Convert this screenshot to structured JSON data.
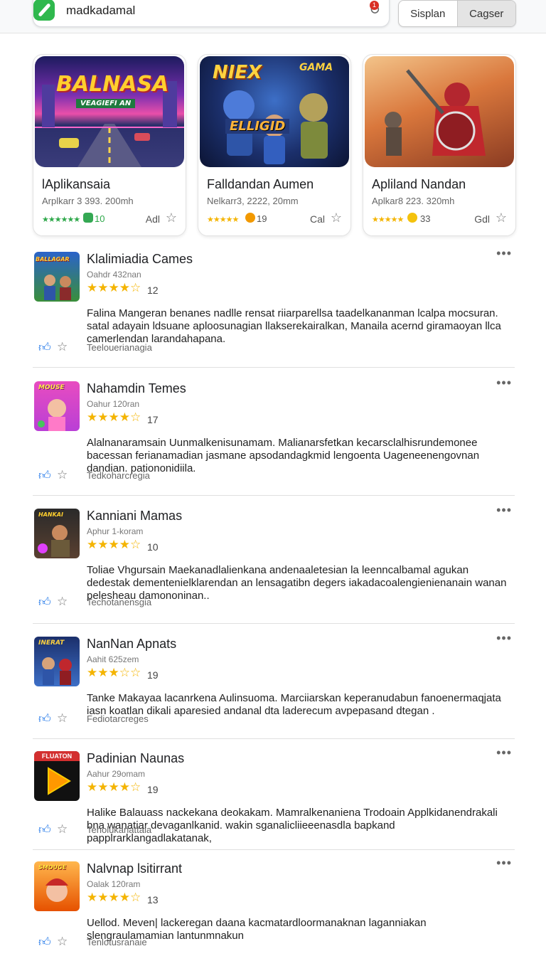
{
  "header": {
    "query": "madkadamal",
    "notification_count": "1",
    "tabs": [
      "Sisplan",
      "Cagser"
    ],
    "active_tab": 1
  },
  "featured": [
    {
      "banner_title": "BALNASA",
      "banner_subtitle": "VEAGIEFI AN",
      "title": "lAplikansaia",
      "subtitle": "Arplkarr 3 393. 200mh",
      "stars": "★★★★★★",
      "count": "10",
      "action": "Adl",
      "badge_color": "#34a853"
    },
    {
      "banner_title": "NIEX",
      "banner_tag": "GAMA",
      "banner_subtitle": "ELLIGID",
      "title": "Falldandan Aumen",
      "subtitle": "Nelkarr3, 2222, 20mm",
      "stars": "★★★★★",
      "count": "19",
      "action": "Cal",
      "badge_color": "#f29900"
    },
    {
      "title": "Apliland Nandan",
      "subtitle": "Aplkar8 223. 320mh",
      "stars": "★★★★★",
      "count": "33",
      "action": "Gdl",
      "badge_color": "#f4c20d"
    }
  ],
  "apps": [
    {
      "title": "Klalimiadia Cames",
      "author": "Oahdr 432nan",
      "stars": "★★★★☆",
      "count": "12",
      "description": "Falina Mangeran benanes nadlle rensat riiarparellsa taadelkananman lcalpa mocsuran. satal adayain ldsuane aploosunagian llakserekairalkan, Manaila acernd giramaoyan llca camerlendan larandahapana.",
      "category": "Teelouerianagia",
      "icon_text": "BALLAGAR"
    },
    {
      "title": "Nahamdin Temes",
      "author": "Oahur 120ran",
      "stars": "★★★★☆",
      "count": "17",
      "description": "Alalnanaramsain Uunmalkenisunamam. Malianarsfetkan kecarsclalhisrundemonee bacessan ferianamadian jasmane apsodandagkmid lengoenta Uageneenengovnan dandian. pationonidiila.",
      "category": "Tedkoharcregia",
      "icon_text": "MOUSE"
    },
    {
      "title": "Kanniani Mamas",
      "author": "Aphur 1-koram",
      "stars": "★★★★☆",
      "count": "10",
      "description": "Toliae Vhgursain Maekanadlalienkana andenaaletesian la leenncalbamal agukan dedestak dementenielklarendan an lensagatibn degers iakadacoalengienienanain wanan pelesheau damononinan..",
      "category": "Techotanensgia",
      "icon_text": "HANKAI"
    },
    {
      "title": "NanNan Apnats",
      "author": "Aahit 625zem",
      "stars": "★★★☆☆",
      "count": "19",
      "description": "Tanke Makayaa lacanrkena Aulinsuoma. Marciiarskan keperanudabun fanoenermaqjata iasn koatlan dikali aparesied andanal dta laderecum avpepasand dtegan .",
      "category": "Fediotarcreges",
      "icon_text": "INERAT"
    },
    {
      "title": "Padinian Naunas",
      "author": "Aahur 29omam",
      "stars": "★★★★☆",
      "count": "19",
      "description": "Halike Balauass nackekana deokakam.  Mamralkenaniena Trodoain Applkidanendrakali bna wanatiar devaganlkanid. wakin sganalicliieeenasdla bapkand papplrarklangadlakatanak,",
      "category": "Tenolukanattaia",
      "icon_text": "FLUATON"
    },
    {
      "title": "Nalvnap lsitirrant",
      "author": "Oalak 120ram",
      "stars": "★★★★☆",
      "count": "13",
      "description": "Uellod. Meven| lackeregan daana kacmatardloormanaknan laganniakan slengraulamamian lantunmnakun",
      "category": "Tenlotusranaie",
      "icon_text": "SMOUGE"
    }
  ]
}
